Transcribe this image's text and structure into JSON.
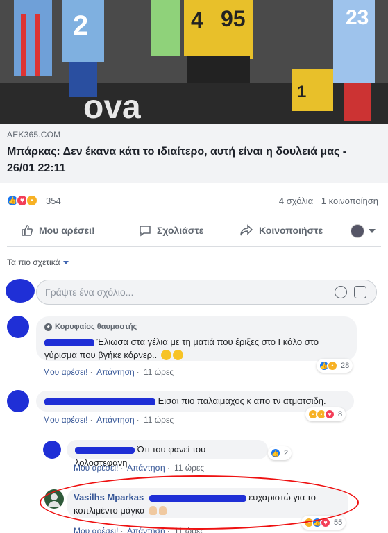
{
  "article": {
    "domain": "AEK365.COM",
    "title": "Μπάρκας: Δεν έκανα κάτι το ιδιαίτερο, αυτή είναι η δουλειά μας - 26/01 22:11"
  },
  "stats": {
    "reaction_count": "354",
    "comments": "4 σχόλια",
    "shares": "1 κοινοποίηση"
  },
  "actions": {
    "like": "Μου αρέσει!",
    "comment": "Σχολιάστε",
    "share": "Κοινοποιήστε"
  },
  "sort_label": "Τα πιο σχετικά",
  "compose": {
    "placeholder": "Γράψτε ένα σχόλιο..."
  },
  "comments": [
    {
      "badge": "Κορυφαίος θαυμαστής",
      "text": "Έλιωσα στα γέλια με τη ματιά που έριξες στο Γκάλο στο γύρισμα που βγήκε κόρνερ..",
      "like": "Μου αρέσει!",
      "reply": "Απάντηση",
      "time": "11 ώρες",
      "reactions": "28"
    },
    {
      "text": "Εισαι πιο παλαιμαχος κ απο τν ατματσιδη.",
      "like": "Μου αρέσει!",
      "reply": "Απάντηση",
      "time": "11 ώρες",
      "reactions": "8"
    }
  ],
  "replies": [
    {
      "text": "Ότι του φανεί του λολοστεφανη",
      "like": "Μου αρέσει!",
      "reply": "Απάντηση",
      "time": "11 ώρες",
      "reactions": "2"
    },
    {
      "name": "Vasilhs Mparkas",
      "text": "ευχαριστώ για το κοπλιμέντο μάγκα",
      "like": "Μου αρέσει!",
      "reply": "Απάντηση",
      "time": "11 ώρες",
      "reactions": "55"
    }
  ],
  "hero_numbers": [
    "2",
    "4",
    "95",
    "23",
    "1"
  ],
  "colors": {
    "link": "#385898",
    "like_blue": "#1877f2",
    "love_red": "#f33e58",
    "annotation_red": "#e11111",
    "scribble_blue": "#1f2fd6"
  }
}
